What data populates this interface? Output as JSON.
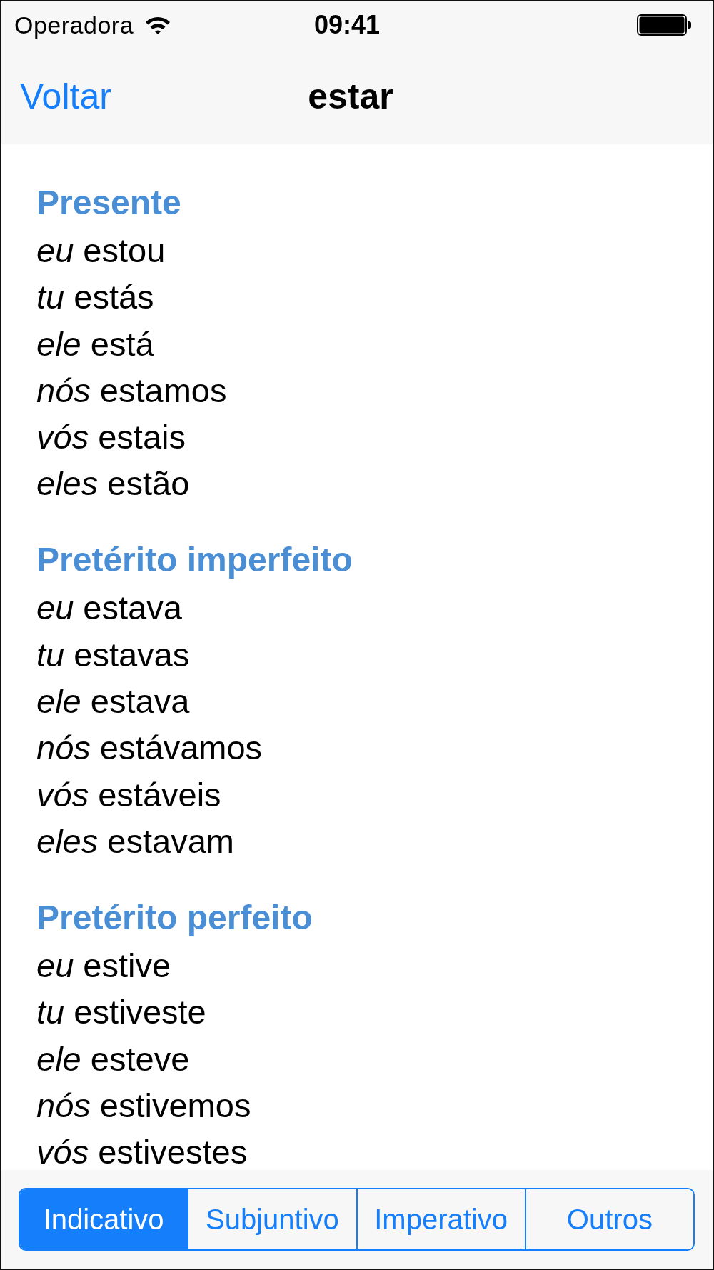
{
  "status_bar": {
    "carrier": "Operadora",
    "time": "09:41"
  },
  "nav_bar": {
    "back": "Voltar",
    "title": "estar"
  },
  "sections": [
    {
      "title": "Presente",
      "lines": [
        "*eu* estou",
        "*tu* estás",
        "*ele* está",
        "*nós* estamos",
        "*vós* estais",
        "*eles* estão"
      ]
    },
    {
      "title": "Pretérito imperfeito",
      "lines": [
        "*eu* estava",
        "*tu* estavas",
        "*ele* estava",
        "*nós* estávamos",
        "*vós* estáveis",
        "*eles* estavam"
      ]
    },
    {
      "title": "Pretérito perfeito",
      "lines": [
        "*eu* estive",
        "*tu* estiveste",
        "*ele* esteve",
        "*nós* estivemos",
        "*vós* estivestes"
      ]
    }
  ],
  "segments": [
    {
      "label": "Indicativo",
      "selected": true
    },
    {
      "label": "Subjuntivo",
      "selected": false
    },
    {
      "label": "Imperativo",
      "selected": false
    },
    {
      "label": "Outros",
      "selected": false
    }
  ]
}
